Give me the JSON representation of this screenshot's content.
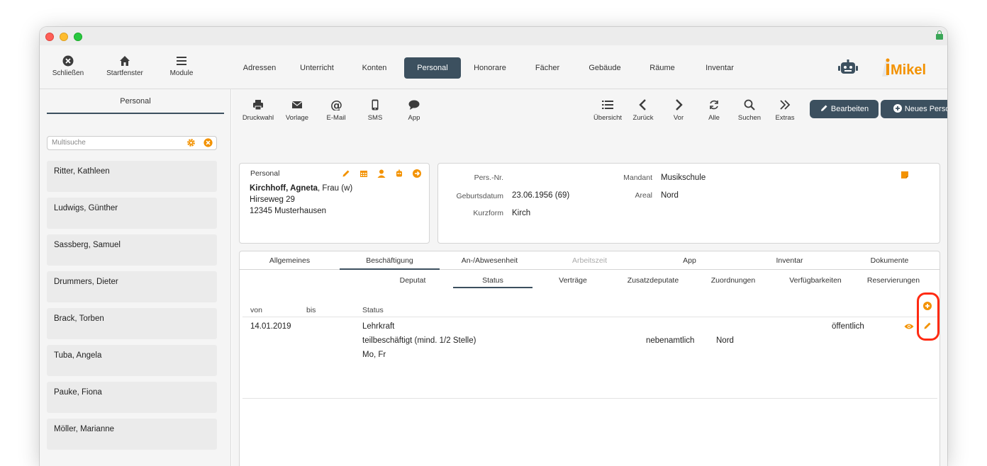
{
  "toolbar_top": {
    "close_label": "Schließen",
    "home_label": "Startfenster",
    "modules_label": "Module"
  },
  "nav": {
    "tabs": [
      {
        "label": "Adressen"
      },
      {
        "label": "Unterricht"
      },
      {
        "label": "Konten"
      },
      {
        "label": "Personal"
      },
      {
        "label": "Honorare"
      },
      {
        "label": "Fächer"
      },
      {
        "label": "Gebäude"
      },
      {
        "label": "Räume"
      },
      {
        "label": "Inventar"
      }
    ],
    "active": "Personal"
  },
  "brand": {
    "logo_i": "i",
    "logo_text": "Mikel",
    "color": "#f39200"
  },
  "sidebar": {
    "title": "Personal",
    "search_placeholder": "Multisuche",
    "items": [
      {
        "name": "Ritter, Kathleen"
      },
      {
        "name": "Ludwigs, Günther"
      },
      {
        "name": "Sassberg, Samuel"
      },
      {
        "name": "Drummers, Dieter"
      },
      {
        "name": "Brack, Torben"
      },
      {
        "name": "Tuba, Angela"
      },
      {
        "name": "Pauke, Fiona"
      },
      {
        "name": "Möller, Marianne"
      }
    ]
  },
  "actions": {
    "left": [
      "Druckwahl",
      "Vorlage",
      "E-Mail",
      "SMS",
      "App"
    ],
    "right": [
      "Übersicht",
      "Zurück",
      "Vor",
      "Alle",
      "Suchen",
      "Extras"
    ],
    "edit_label": "Bearbeiten",
    "new_label": "Neues Personal"
  },
  "person_card": {
    "title": "Personal",
    "name_bold": "Kirchhoff, Agneta",
    "name_rest": ", Frau (w)",
    "street": "Hirseweg 29",
    "city": "12345 Musterhausen"
  },
  "details": {
    "persnr_label": "Pers.-Nr.",
    "persnr_value": "",
    "birth_label": "Geburtsdatum",
    "birth_value": "23.06.1956 (69)",
    "short_label": "Kurzform",
    "short_value": "Kirch",
    "client_label": "Mandant",
    "client_value": "Musikschule",
    "area_label": "Areal",
    "area_value": "Nord"
  },
  "tabs_main": [
    {
      "label": "Allgemeines"
    },
    {
      "label": "Beschäftigung"
    },
    {
      "label": "An-/Abwesenheit"
    },
    {
      "label": "Arbeitszeit"
    },
    {
      "label": "App"
    },
    {
      "label": "Inventar"
    },
    {
      "label": "Dokumente"
    }
  ],
  "tabs_sub": [
    {
      "label": "Deputat"
    },
    {
      "label": "Status"
    },
    {
      "label": "Verträge"
    },
    {
      "label": "Zusatzdeputate"
    },
    {
      "label": "Zuordnungen"
    },
    {
      "label": "Verfügbarkeiten"
    },
    {
      "label": "Reservierungen"
    }
  ],
  "status_table": {
    "headers": {
      "from": "von",
      "to": "bis",
      "status": "Status"
    },
    "rows": [
      {
        "from": "14.01.2019",
        "to": "",
        "status": "Lehrkraft",
        "employment": "teilbeschäftigt (mind. 1/2 Stelle)",
        "days": "Mo, Fr",
        "type": "nebenamtlich",
        "area": "Nord",
        "visibility": "öffentlich"
      }
    ]
  },
  "colors": {
    "accent": "#f39200",
    "dark": "#3c505f",
    "highlight": "#ff2a12"
  }
}
